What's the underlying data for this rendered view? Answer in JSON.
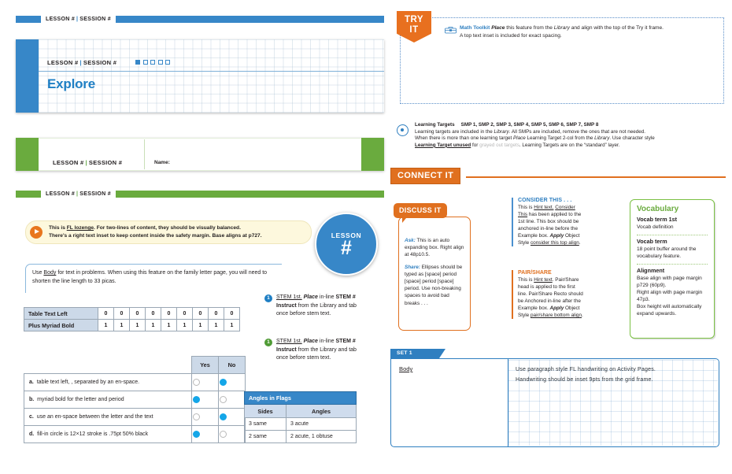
{
  "left": {
    "rule_bar": {
      "lesson": "LESSON #",
      "session": "SESSION #"
    },
    "explore_card": {
      "lesson": "LESSON #",
      "session": "SESSION #",
      "title": "Explore",
      "dots_total": 5,
      "dots_filled": 1
    },
    "name_card": {
      "lesson": "LESSON #",
      "session": "SESSION #",
      "name_label": "Name:"
    },
    "green_rule_bar": {
      "lesson": "LESSON #",
      "session": "SESSION #"
    },
    "lozenge": {
      "line1_a": "This is ",
      "line1_link": "FL lozenge",
      "line1_b": ". For two-lines of content, they should be visually balanced.",
      "line2": "There's a right text inset to keep content inside the safety margin. Base aligns at p727."
    },
    "body_note": {
      "a": "Use ",
      "link": "Body",
      "b": " for text in problems. When using this feature on the family letter page, you will need to shorten the line length to 33 picas."
    },
    "lesson_badge": {
      "word": "LESSON",
      "hash": "#"
    },
    "stems": [
      {
        "num": "1",
        "color": "blue",
        "link": "STEM 1st.",
        "bold_ital": " Place",
        "mid": " in-line ",
        "bold": "STEM # Instruct",
        "tail": " from the Library and tab once before stem text."
      },
      {
        "num": "1",
        "color": "green",
        "link": "STEM 1st.",
        "bold_ital": " Place",
        "mid": " in-line ",
        "bold": "STEM # Instruct",
        "tail": " from the Library and tab once before stem text."
      }
    ],
    "number_table": {
      "rows": [
        {
          "label": "Table Text Left",
          "values": [
            "0",
            "0",
            "0",
            "0",
            "0",
            "0",
            "0",
            "0",
            "0"
          ]
        },
        {
          "label": "Plus Myriad Bold",
          "values": [
            "1",
            "1",
            "1",
            "1",
            "1",
            "1",
            "1",
            "1",
            "1"
          ]
        }
      ]
    },
    "yesno_table": {
      "headers": [
        "Yes",
        "No"
      ],
      "rows": [
        {
          "letter": "a.",
          "text": "table text left, , separated by an en-space.",
          "yes": false,
          "no": true
        },
        {
          "letter": "b.",
          "text": "myriad bold for the letter and period",
          "yes": true,
          "no": false
        },
        {
          "letter": "c.",
          "text": "use an en-space between the letter and the text",
          "yes": false,
          "no": true
        },
        {
          "letter": "d.",
          "text": "fill-in circle is 12×12 stroke is .75pt 50% black",
          "yes": true,
          "no": false
        }
      ]
    },
    "flags_table": {
      "caption": "Angles in Flags",
      "headers": [
        "Sides",
        "Angles"
      ],
      "rows": [
        [
          "3 same",
          "3 acute"
        ],
        [
          "2 same",
          "2 acute, 1 obtuse"
        ]
      ]
    }
  },
  "right": {
    "try_it": {
      "badge_line1": "TRY",
      "badge_line2": "IT",
      "toolkit_label": "Math Toolkit",
      "toolkit_place": "Place",
      "toolkit_text_a": " this feature from the ",
      "toolkit_library": "Library",
      "toolkit_text_b": " and align with the top of the Try it frame.",
      "toolkit_line2": "A top text inset is included for exact spacing."
    },
    "learning_targets": {
      "heading": "Learning Targets",
      "smps": "SMP 1, SMP 2, SMP 3, SMP 4, SMP 5, SMP 6, SMP 7, SMP 8",
      "line1_a": "Learning targets are included in the ",
      "line1_lib": "Library",
      "line1_b": ". All SMPs are included, remove the ones that are not needed.",
      "line2_a": "When there is more than one learning target ",
      "line2_place": "Place",
      "line2_b": " Learning Target 2-col from the ",
      "line2_lib": "Library",
      "line2_c": ".  Use character style",
      "line3_link": "Learning Target unused",
      "line3_a": " for ",
      "line3_gray": "grayed out targets",
      "line3_b": ". Learning Targets are on the “standard” layer."
    },
    "connect_it": {
      "label": "CONNECT IT"
    },
    "discuss_it": {
      "tag": "DISCUSS IT",
      "ask_key": "Ask:",
      "ask_text": " This is an auto expanding box. Right align at 48p10.5.",
      "share_key": "Share:",
      "share_text": " Ellipses should be typed as [space] period [space] period [space] period. Use non-breaking spaces to avoid bad breaks . . ."
    },
    "consider_this": {
      "heading": "CONSIDER THIS . . .",
      "a": "This is ",
      "link1": "Hint text.",
      "link2": "Consider This",
      "b": " has been applied to the 1st line. This box should be anchored in-line before the Example box. ",
      "apply": "Apply",
      "c": " Object Style ",
      "link3": "consider this top align",
      "d": "."
    },
    "pair_share": {
      "heading": "PAIR/SHARE",
      "a": "This is ",
      "link1": "Hint text",
      "b": ". Pair/Share head is applied to the first line. Pair/Share Recto should be Anchored in-line after the Example box. ",
      "apply": "Apply",
      "c": " Object Style ",
      "link2": "pair/share bottom align",
      "d": "."
    },
    "vocabulary": {
      "title": "Vocabulary",
      "entries": [
        {
          "term": "Vocab term 1st",
          "def": "Vocab definition"
        },
        {
          "term": "Vocab term",
          "def": "18 point buffer around the vocabulary feature."
        },
        {
          "term": "Alignment",
          "def": "Base align with page margin p729 (60p9).\nRight align with page margin 47p3.\nBox height will automatically expand upwards."
        }
      ]
    },
    "set": {
      "tab_label": "SET 1",
      "body_label": "Body",
      "line1": "Use paragraph style FL handwriting on Activity Pages.",
      "line2": "Handwriting should be inset 9pts from the grid frame."
    }
  },
  "colors": {
    "blue": "#3787c8",
    "blue_dark": "#1f7fc4",
    "green": "#6aab3e",
    "orange": "#e0701f",
    "cyan": "#14a6e8",
    "header_fill": "#ccd9e8"
  }
}
